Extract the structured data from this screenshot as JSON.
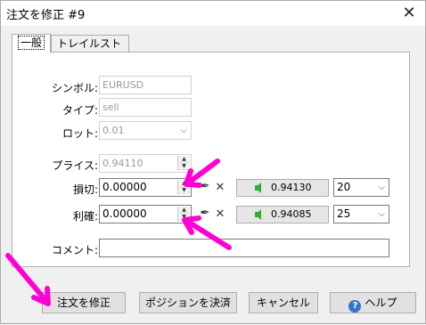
{
  "window": {
    "title": "注文を修正 #9",
    "close_glyph": "✕"
  },
  "tabs": [
    {
      "label": "一般",
      "active": true
    },
    {
      "label": "トレイルストップ",
      "active": false
    }
  ],
  "form": {
    "symbol": {
      "label": "シンボル:",
      "value": "EURUSD"
    },
    "type": {
      "label": "タイプ:",
      "value": "sell"
    },
    "lot": {
      "label": "ロット:",
      "value": "0.01"
    },
    "price": {
      "label": "プライス:",
      "value": "0.94110"
    },
    "stoploss": {
      "label": "損切:",
      "value": "0.00000",
      "market_price": "0.94130",
      "points": "20"
    },
    "takeprofit": {
      "label": "利確:",
      "value": "0.00000",
      "market_price": "0.94085",
      "points": "25"
    },
    "comment": {
      "label": "コメント:",
      "value": ""
    }
  },
  "buttons": {
    "modify": "注文を修正",
    "close_position": "ポジションを決済",
    "cancel": "キャンセル",
    "help": "ヘルプ"
  },
  "icons": {
    "spin_up": "▲",
    "spin_down": "▼",
    "chevron": "⌵",
    "pick": "✒",
    "clear": "✕",
    "help": "?"
  },
  "colors": {
    "annotation_arrow": "#ff00d4",
    "price_arrow": "#2fb12f",
    "help_icon": "#2e78c7"
  }
}
